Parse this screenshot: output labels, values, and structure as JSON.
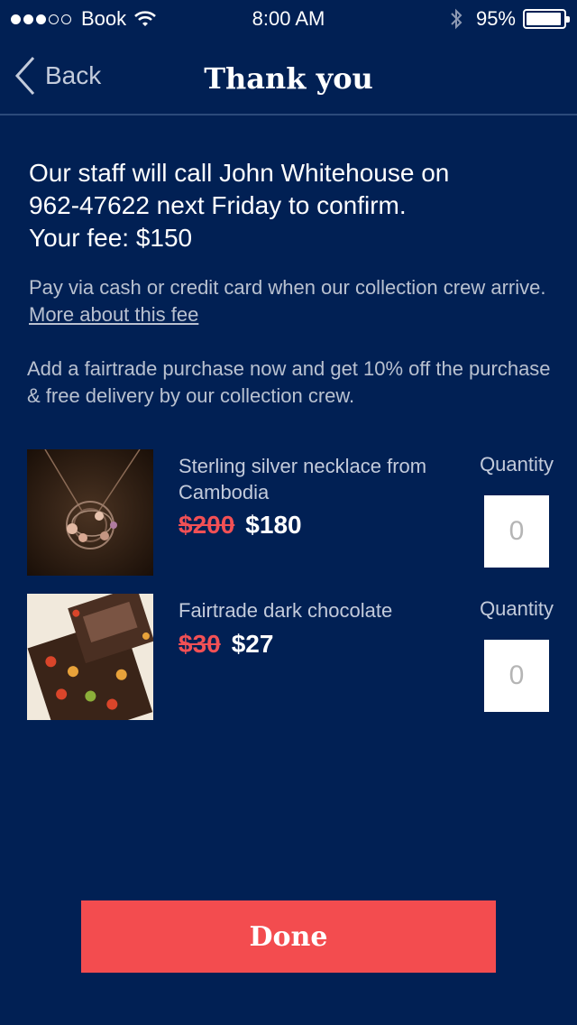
{
  "status_bar": {
    "carrier": "Book",
    "time": "8:00 AM",
    "battery_percent_label": "95%",
    "battery_level": 0.95,
    "signal_bars_filled": 3,
    "signal_bars_total": 5
  },
  "nav": {
    "back_label": "Back",
    "title": "Thank you"
  },
  "confirmation": {
    "line1": "Our staff will call John Whitehouse on",
    "line2": "962-47622 next Friday to confirm.",
    "line3": "Your fee: $150"
  },
  "payment_note": {
    "text": "Pay via cash or credit card when our collection crew arrive. ",
    "link_label": "More about this fee"
  },
  "offer_note": "Add a fairtrade purchase now and get 10% off the purchase & free delivery by our collection crew.",
  "products": [
    {
      "name": "Sterling silver necklace from Cambodia",
      "old_price": "$200",
      "new_price": "$180",
      "quantity_label": "Quantity",
      "quantity_value": "0",
      "image_icon": "necklace-photo"
    },
    {
      "name": "Fairtrade dark chocolate",
      "old_price": "$30",
      "new_price": "$27",
      "quantity_label": "Quantity",
      "quantity_value": "0",
      "image_icon": "chocolate-photo"
    }
  ],
  "done_label": "Done",
  "colors": {
    "background": "#012054",
    "accent_red": "#f34c4f",
    "strike_price": "#f25055",
    "muted_text": "#b9c1d0"
  }
}
